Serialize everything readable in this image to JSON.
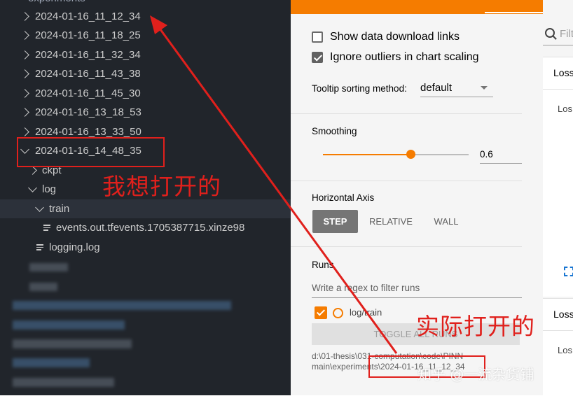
{
  "explorer": {
    "header": "experiments",
    "folders": [
      "2024-01-16_11_12_34",
      "2024-01-16_11_18_25",
      "2024-01-16_11_32_34",
      "2024-01-16_11_43_38",
      "2024-01-16_11_45_30",
      "2024-01-16_13_18_53",
      "2024-01-16_13_33_50",
      "2024-01-16_14_48_35"
    ],
    "ckpt": "ckpt",
    "log": "log",
    "train": "train",
    "events_file": "events.out.tfevents.1705387715.xinze98",
    "logging_file": "logging.log"
  },
  "tensorboard": {
    "show_download": "Show data download links",
    "ignore_outliers": "Ignore outliers in chart scaling",
    "tooltip_label": "Tooltip sorting method:",
    "tooltip_value": "default",
    "smoothing_label": "Smoothing",
    "smoothing_value": "0.6",
    "horizontal_axis_label": "Horizontal Axis",
    "axis_options": [
      "STEP",
      "RELATIVE",
      "WALL"
    ],
    "runs_label": "Runs",
    "runs_filter_placeholder": "Write a regex to filter runs",
    "run_name": "log/train",
    "toggle_all": "TOGGLE ALL RUNS",
    "logdir_line1": "d:\\01-thesis\\031-computation\\code\\PINN",
    "logdir_line2": "main\\experiments\\2024-01-16_11_12_34",
    "filter_tags": "Filt",
    "card_title_1": "Loss",
    "card_sub_1": "Los",
    "card_title_2": "Loss",
    "card_sub_2": "Los"
  },
  "annotations": {
    "want_to_open": "我想打开的",
    "actually_opened": "实际打开的",
    "watermark": "知乎 @一流杂货铺"
  },
  "colors": {
    "annotation_red": "#e0201c",
    "tensorboard_orange": "#f57c00",
    "run_checkbox": "#f57c00",
    "explorer_bg": "#21252b"
  }
}
